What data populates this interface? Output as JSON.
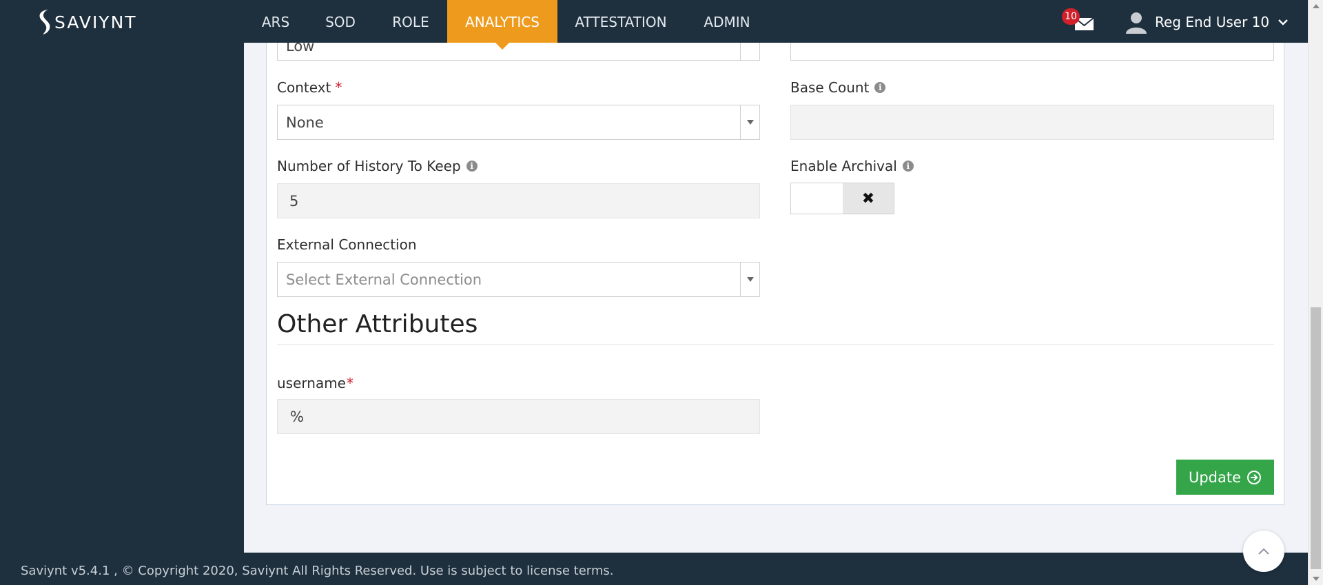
{
  "header": {
    "logo_text": "SAVIYNT",
    "nav": [
      {
        "label": "ARS",
        "active": false
      },
      {
        "label": "SOD",
        "active": false
      },
      {
        "label": "ROLE",
        "active": false
      },
      {
        "label": "ANALYTICS",
        "active": true
      },
      {
        "label": "ATTESTATION",
        "active": false
      },
      {
        "label": "ADMIN",
        "active": false
      }
    ],
    "notifications": {
      "count": "10",
      "icon": "envelope-icon"
    },
    "user": {
      "name": "Reg End User 10",
      "icon": "user-icon",
      "menu_icon": "chevron-down-icon"
    }
  },
  "form": {
    "risk_value": "Low",
    "context": {
      "label": "Context",
      "required": "*",
      "value": "None"
    },
    "base_count": {
      "label": "Base Count",
      "value": ""
    },
    "history": {
      "label": "Number of History To Keep",
      "value": "5"
    },
    "archival": {
      "label": "Enable Archival",
      "state": "off",
      "icon": "✖"
    },
    "external_connection": {
      "label": "External Connection",
      "placeholder": "Select External Connection"
    },
    "other_attributes": {
      "title": "Other Attributes",
      "username": {
        "label": "username",
        "required": "*",
        "value": "%"
      }
    },
    "update_button": {
      "label": "Update",
      "icon": "arrow-right-circle-icon"
    }
  },
  "footer": {
    "text": "Saviynt v5.4.1 , © Copyright  2020, Saviynt All Rights Reserved. Use is subject to license terms."
  },
  "colors": {
    "nav_bg": "#1e2f3e",
    "active_nav": "#ee9b1d",
    "update_button": "#34a548",
    "required": "#d0202a"
  }
}
